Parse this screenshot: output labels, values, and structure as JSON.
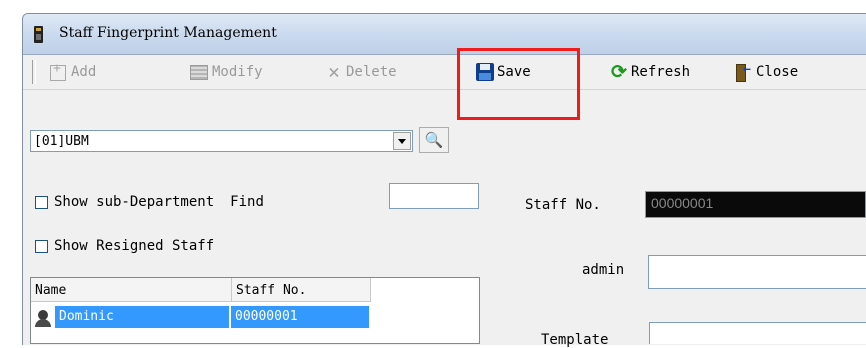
{
  "window": {
    "title": "Staff Fingerprint Management",
    "icon": "fingerprint-device-icon"
  },
  "toolbar": {
    "add_label": "Add",
    "modify_label": "Modify",
    "delete_label": "Delete",
    "save_label": "Save",
    "refresh_label": "Refresh",
    "close_label": "Close"
  },
  "department": {
    "selected": "[01]UBM",
    "find_icon": "binoculars-icon"
  },
  "options": {
    "show_sub_department": "Show sub-Department",
    "show_resigned_staff": "Show Resigned Staff",
    "find_label": "Find",
    "find_value": ""
  },
  "staff_list": {
    "columns": [
      "Name",
      "Staff No."
    ],
    "rows": [
      {
        "name": "Dominic",
        "staff_no": "00000001",
        "selected": true
      }
    ]
  },
  "form": {
    "staff_no_label": "Staff No.",
    "staff_no_value": "00000001",
    "admin_label": "admin",
    "admin_value": "",
    "template_label": "Template"
  },
  "colors": {
    "highlight": "#ee1c1c",
    "selection": "#3399ff",
    "titlebar": "#c9d9ee"
  }
}
